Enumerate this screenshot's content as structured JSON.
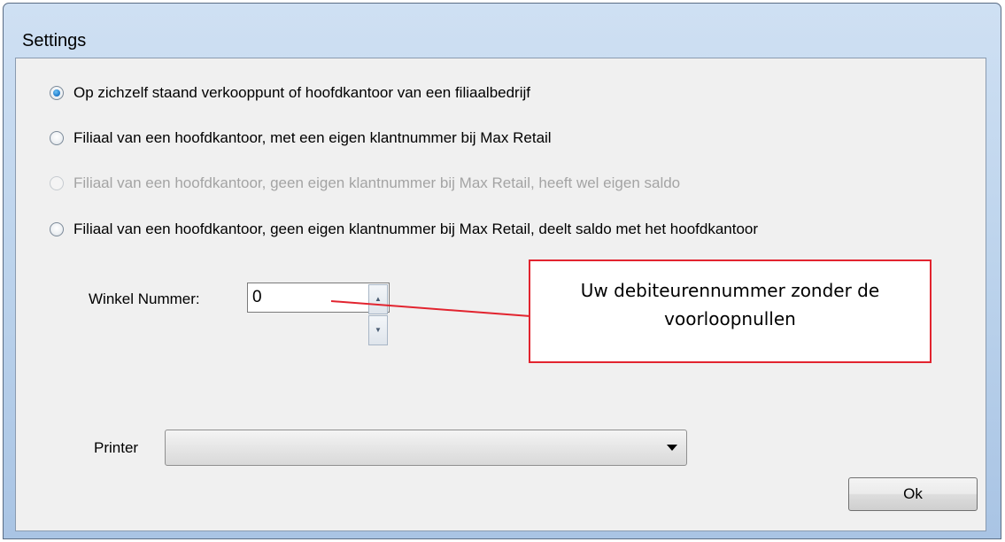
{
  "window": {
    "title": "Settings"
  },
  "options": [
    {
      "label": "Op zichzelf staand verkooppunt of hoofdkantoor van een filiaalbedrijf",
      "checked": true,
      "disabled": false
    },
    {
      "label": "Filiaal van een hoofdkantoor,  met een eigen klantnummer bij Max Retail",
      "checked": false,
      "disabled": false
    },
    {
      "label": "Filiaal van een hoofdkantoor,  geen eigen klantnummer bij Max Retail, heeft wel eigen saldo",
      "checked": false,
      "disabled": true
    },
    {
      "label": "Filiaal van een hoofdkantoor,  geen eigen klantnummer bij Max Retail, deelt saldo met het hoofdkantoor",
      "checked": false,
      "disabled": false
    }
  ],
  "winkel": {
    "label": "Winkel Nummer:",
    "value": "0"
  },
  "callout": {
    "line1": "Uw debiteurennummer zonder de",
    "line2": "voorloopnullen",
    "color": "#e2242f"
  },
  "printer": {
    "label": "Printer",
    "value": ""
  },
  "ok": {
    "label": "Ok"
  }
}
